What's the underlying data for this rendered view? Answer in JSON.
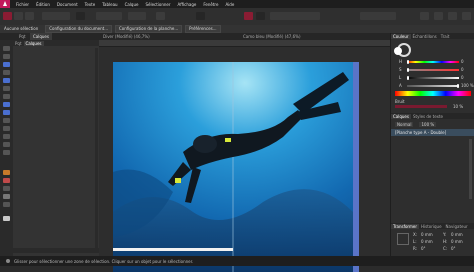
{
  "app": {
    "brand_color": "#c2185b",
    "accent": "#8a1c33"
  },
  "menu": [
    "Fichier",
    "Édition",
    "Document",
    "Texte",
    "Tableau",
    "Calque",
    "Sélectionner",
    "Affichage",
    "Fenêtre",
    "Aide"
  ],
  "context_bar": {
    "items": [
      "Aucune sélection",
      "Configuration du document...",
      "Configuration de la planche...",
      "Préférences..."
    ]
  },
  "doc_tabs": [
    {
      "label": "Pqt",
      "active": false
    },
    {
      "label": "Calques",
      "active": true
    },
    {
      "label": "Diver (Modifié) (46,7%)",
      "active": false
    },
    {
      "label": "Camo bleu (Modifié) (47,6%)",
      "active": false
    }
  ],
  "right_panel": {
    "tabs": [
      "Couleur",
      "Échantillons",
      "Trait"
    ],
    "color_rows": [
      {
        "label": "H",
        "value": "0"
      },
      {
        "label": "S",
        "value": "0"
      },
      {
        "label": "L",
        "value": "0"
      },
      {
        "label": "A",
        "value": "100 %"
      }
    ],
    "opacity_label": "Bruit",
    "opacity_value": "10 %",
    "layers_tabs": [
      "Calques",
      "Styles de texte"
    ],
    "layers_header": [
      "Normal",
      "100 %"
    ],
    "layer_item": "[Planche type A - Double]",
    "transform_tabs": [
      "Transformer",
      "Historique",
      "Navigateur"
    ],
    "transform_fields": [
      {
        "label": "X:",
        "value": "0 mm"
      },
      {
        "label": "Y:",
        "value": "0 mm"
      },
      {
        "label": "L:",
        "value": "0 mm"
      },
      {
        "label": "H:",
        "value": "0 mm"
      },
      {
        "label": "R:",
        "value": "0°"
      },
      {
        "label": "C:",
        "value": "0°"
      }
    ]
  },
  "pages_panel": {
    "search_placeholder": "Rechercher"
  },
  "status": "Glisser pour sélectionner une zone de sélection. Cliquer sur un objet pour le sélectionner.",
  "icons": [
    "grid-icon",
    "move-tool-icon",
    "node-tool-icon",
    "text-tool-icon",
    "pen-tool-icon",
    "zoom-tool-icon"
  ]
}
